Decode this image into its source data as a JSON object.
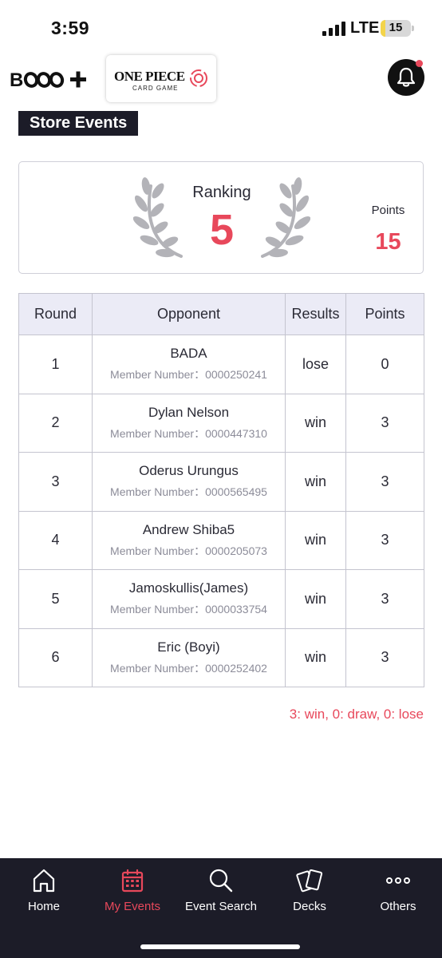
{
  "status_bar": {
    "time": "3:59",
    "network": "LTE",
    "battery": "15",
    "battery_level": 0.15
  },
  "header": {
    "brand_logo": "B-ooo+",
    "game_logo_title": "ONE PIECE",
    "game_logo_subtitle": "CARD GAME",
    "notification_icon": "bell-icon"
  },
  "section": {
    "title": "Store Events"
  },
  "ranking": {
    "label": "Ranking",
    "value": "5",
    "points_label": "Points",
    "points_value": "15"
  },
  "table": {
    "headers": {
      "round": "Round",
      "opponent": "Opponent",
      "results": "Results",
      "points": "Points"
    },
    "rows": [
      {
        "round": "1",
        "name": "BADA",
        "member": "Member Number：0000250241",
        "result": "lose",
        "points": "0"
      },
      {
        "round": "2",
        "name": "Dylan Nelson",
        "member": "Member Number：0000447310",
        "result": "win",
        "points": "3"
      },
      {
        "round": "3",
        "name": "Oderus Urungus",
        "member": "Member Number：0000565495",
        "result": "win",
        "points": "3"
      },
      {
        "round": "4",
        "name": "Andrew Shiba5",
        "member": "Member Number：0000205073",
        "result": "win",
        "points": "3"
      },
      {
        "round": "5",
        "name": "Jamoskullis(James)",
        "member": "Member Number：0000033754",
        "result": "win",
        "points": "3"
      },
      {
        "round": "6",
        "name": "Eric (Boyi)",
        "member": "Member Number：0000252402",
        "result": "win",
        "points": "3"
      }
    ]
  },
  "legend": "3: win, 0: draw, 0: lose",
  "nav": {
    "items": [
      {
        "label": "Home",
        "icon": "home-icon"
      },
      {
        "label": "My Events",
        "icon": "calendar-icon"
      },
      {
        "label": "Event Search",
        "icon": "search-icon"
      },
      {
        "label": "Decks",
        "icon": "cards-icon"
      },
      {
        "label": "Others",
        "icon": "more-icon"
      }
    ],
    "active": "My Events"
  },
  "colors": {
    "accent": "#e8485b",
    "dark": "#1c1c28",
    "table_header_bg": "#ebebf6",
    "laurel": "#b3b3b8"
  }
}
